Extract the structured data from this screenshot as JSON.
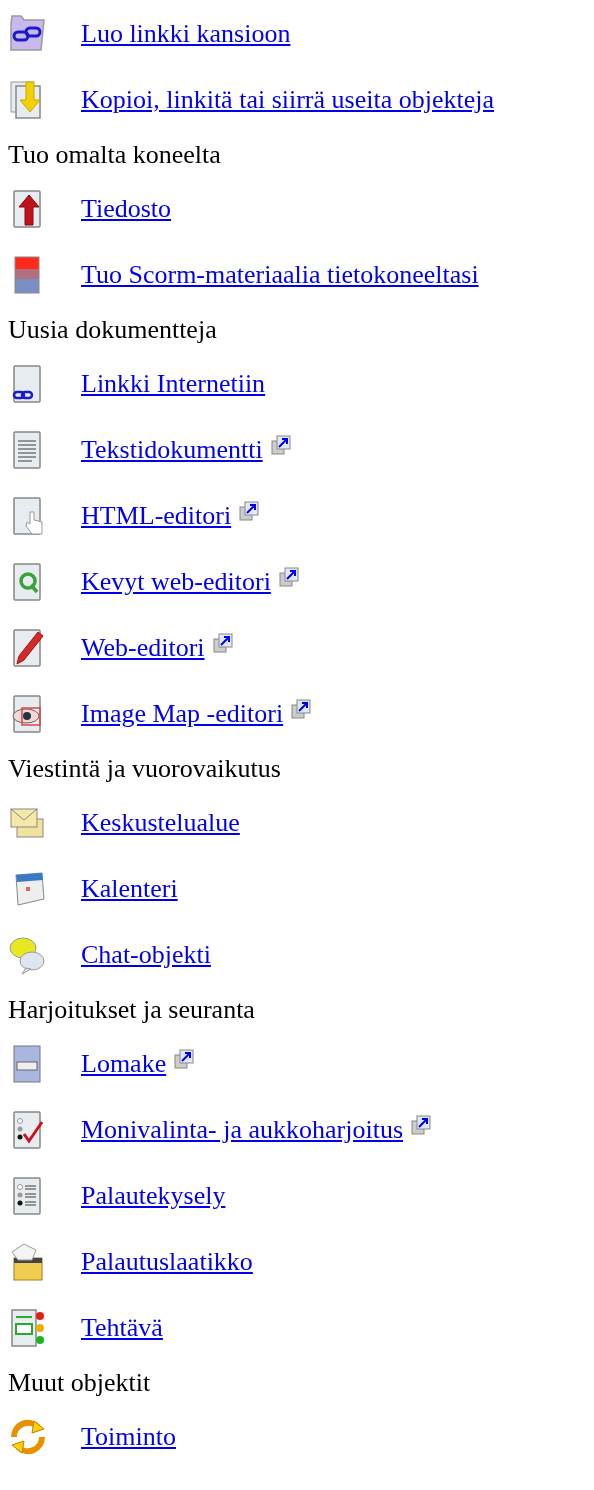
{
  "sections": [
    {
      "items": [
        {
          "label": "Luo linkki kansioon",
          "kind": "folder-link",
          "external": false
        },
        {
          "label": "Kopioi, linkitä tai siirrä useita objekteja",
          "kind": "copy",
          "external": false
        }
      ]
    },
    {
      "heading": "Tuo omalta koneelta",
      "items": [
        {
          "label": "Tiedosto",
          "kind": "upload",
          "external": false
        },
        {
          "label": "Tuo Scorm-materiaalia tietokoneeltasi",
          "kind": "scorm",
          "external": false
        }
      ]
    },
    {
      "heading": "Uusia dokumentteja",
      "items": [
        {
          "label": "Linkki Internetiin",
          "kind": "weblink",
          "external": false
        },
        {
          "label": "Tekstidokumentti",
          "kind": "text",
          "external": true
        },
        {
          "label": "HTML-editori",
          "kind": "html",
          "external": true
        },
        {
          "label": "Kevyt web-editori",
          "kind": "quick",
          "external": true
        },
        {
          "label": "Web-editori",
          "kind": "pencil",
          "external": true
        },
        {
          "label": "Image Map -editori",
          "kind": "imagemap",
          "external": true
        }
      ]
    },
    {
      "heading": "Viestintä ja vuorovaikutus",
      "items": [
        {
          "label": "Keskustelualue",
          "kind": "forum",
          "external": false
        },
        {
          "label": "Kalenteri",
          "kind": "calendar",
          "external": false
        },
        {
          "label": "Chat-objekti",
          "kind": "chat",
          "external": false
        }
      ]
    },
    {
      "heading": "Harjoitukset ja seuranta",
      "items": [
        {
          "label": "Lomake",
          "kind": "form",
          "external": true
        },
        {
          "label": "Monivalinta- ja aukkoharjoitus",
          "kind": "quiz",
          "external": true
        },
        {
          "label": "Palautekysely",
          "kind": "survey",
          "external": false
        },
        {
          "label": "Palautuslaatikko",
          "kind": "dropbox",
          "external": false
        },
        {
          "label": "Tehtävä",
          "kind": "task",
          "external": false
        }
      ]
    },
    {
      "heading": "Muut objektit",
      "items": [
        {
          "label": "Toiminto",
          "kind": "activity",
          "external": false
        }
      ]
    }
  ]
}
